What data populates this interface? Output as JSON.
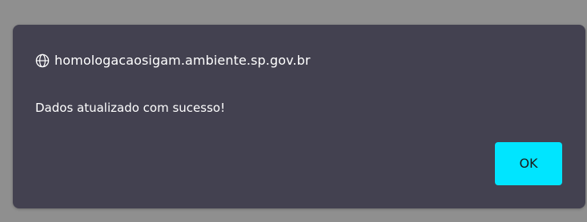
{
  "dialog": {
    "origin": "homologacaosigam.ambiente.sp.gov.br",
    "origin_icon": "globe-icon",
    "message": "Dados atualizado com sucesso!",
    "ok_label": "OK"
  },
  "colors": {
    "backdrop": "#8f8f8f",
    "dialog_background": "#434150",
    "text": "#ffffff",
    "button_background": "#00e5ff",
    "button_text": "#1b1b1b"
  }
}
